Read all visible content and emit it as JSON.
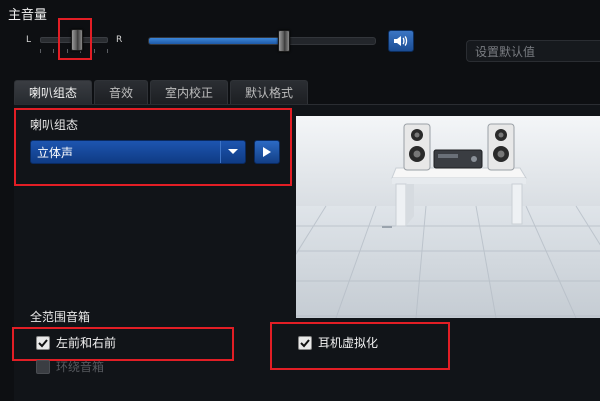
{
  "header": {
    "title": "主音量",
    "balance_left": "L",
    "balance_right": "R"
  },
  "volume": {
    "level_percent": 59,
    "balance_percent": 60
  },
  "default_button": {
    "label": "设置默认值"
  },
  "tabs": [
    {
      "label": "喇叭组态",
      "active": true
    },
    {
      "label": "音效",
      "active": false
    },
    {
      "label": "室内校正",
      "active": false
    },
    {
      "label": "默认格式",
      "active": false
    }
  ],
  "speaker_config": {
    "section_label": "喇叭组态",
    "selected": "立体声"
  },
  "fullrange": {
    "section_label": "全范围音箱",
    "front": {
      "label": "左前和右前",
      "checked": true
    },
    "surround": {
      "label": "环绕音箱",
      "checked": false,
      "disabled": true
    }
  },
  "headphone": {
    "label": "耳机虚拟化",
    "checked": true
  },
  "colors": {
    "accent": "#1f5aa8",
    "highlight_box": "#e21e25"
  }
}
